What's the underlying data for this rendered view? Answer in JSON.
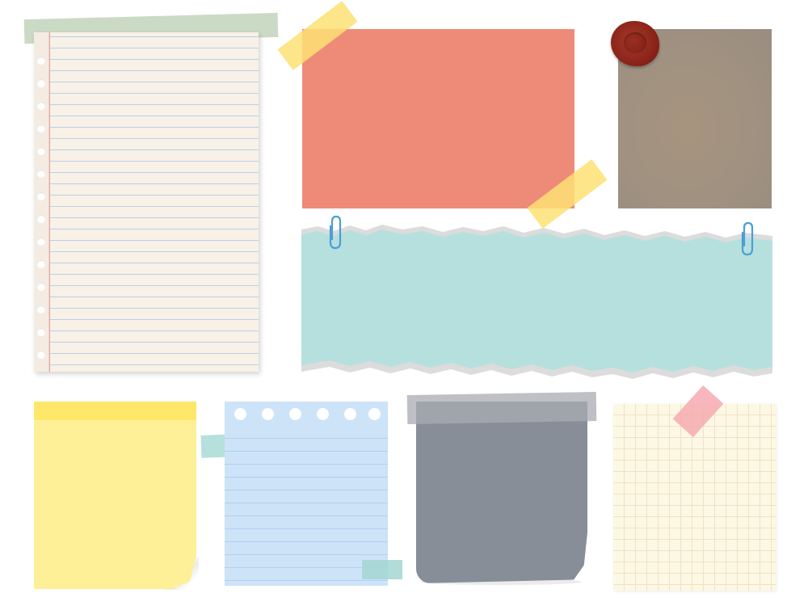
{
  "scene": {
    "background": "#ffffff",
    "items": [
      {
        "name": "lined-notebook-page",
        "color": "#f8f1e7",
        "line_color": "#b9cfe6",
        "tape_color": "#c5d6bf"
      },
      {
        "name": "coral-card",
        "color": "#ee8b78",
        "tape_color": "#fde174"
      },
      {
        "name": "kraft-card",
        "color": "#a09180",
        "seal_color": "#8c2419"
      },
      {
        "name": "torn-teal-strip",
        "color": "#b6e0dd",
        "clip_color": "#4a9fd6"
      },
      {
        "name": "yellow-sticky-note",
        "color": "#fef097",
        "band_color": "#ffe76a"
      },
      {
        "name": "blue-notebook-page",
        "color": "#cde3f8"
      },
      {
        "name": "slate-note",
        "color": "#878e98",
        "tape_color": "#a8abb2"
      },
      {
        "name": "grid-note",
        "color": "#fdf8e3",
        "tape_color": "#f6aab0"
      }
    ]
  }
}
